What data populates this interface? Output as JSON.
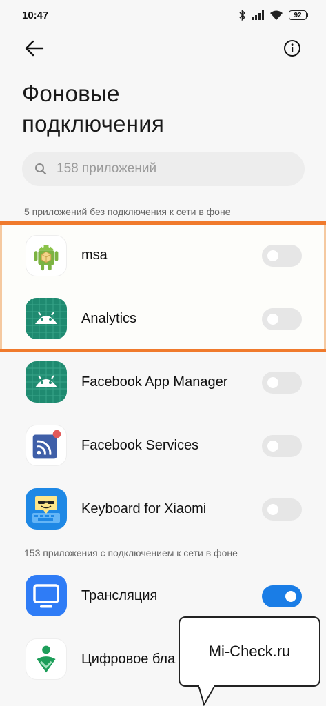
{
  "status_bar": {
    "time": "10:47",
    "battery": "92"
  },
  "top_bar": {
    "back_icon": "arrow-left-icon",
    "info_icon": "info-icon"
  },
  "title_line1": "Фоновые",
  "title_line2": "подключения",
  "search": {
    "placeholder": "158 приложений"
  },
  "section_off": {
    "label": "5 приложений без подключения к сети в фоне",
    "apps": [
      {
        "name": "msa",
        "icon": "android-cube-icon",
        "enabled": false
      },
      {
        "name": "Analytics",
        "icon": "android-grid-icon",
        "enabled": false
      },
      {
        "name": "Facebook App Manager",
        "icon": "android-grid-icon",
        "enabled": false
      },
      {
        "name": "Facebook Services",
        "icon": "facebook-services-icon",
        "enabled": false
      },
      {
        "name": "Keyboard for Xiaomi",
        "icon": "keyboard-emoji-icon",
        "enabled": false
      }
    ]
  },
  "section_on": {
    "label": "153 приложения с подключением к сети в фоне",
    "apps": [
      {
        "name": "Трансляция",
        "icon": "cast-monitor-icon",
        "enabled": true
      },
      {
        "name": "Цифровое бла",
        "icon": "digital-wellbeing-icon",
        "enabled": true
      }
    ]
  },
  "watermark": {
    "text": "Mi-Check.ru"
  },
  "colors": {
    "highlight": "#f07a2c",
    "toggle_on": "#1a7de6",
    "toggle_off": "#e6e6e6",
    "android_teal": "#1f8a70"
  }
}
